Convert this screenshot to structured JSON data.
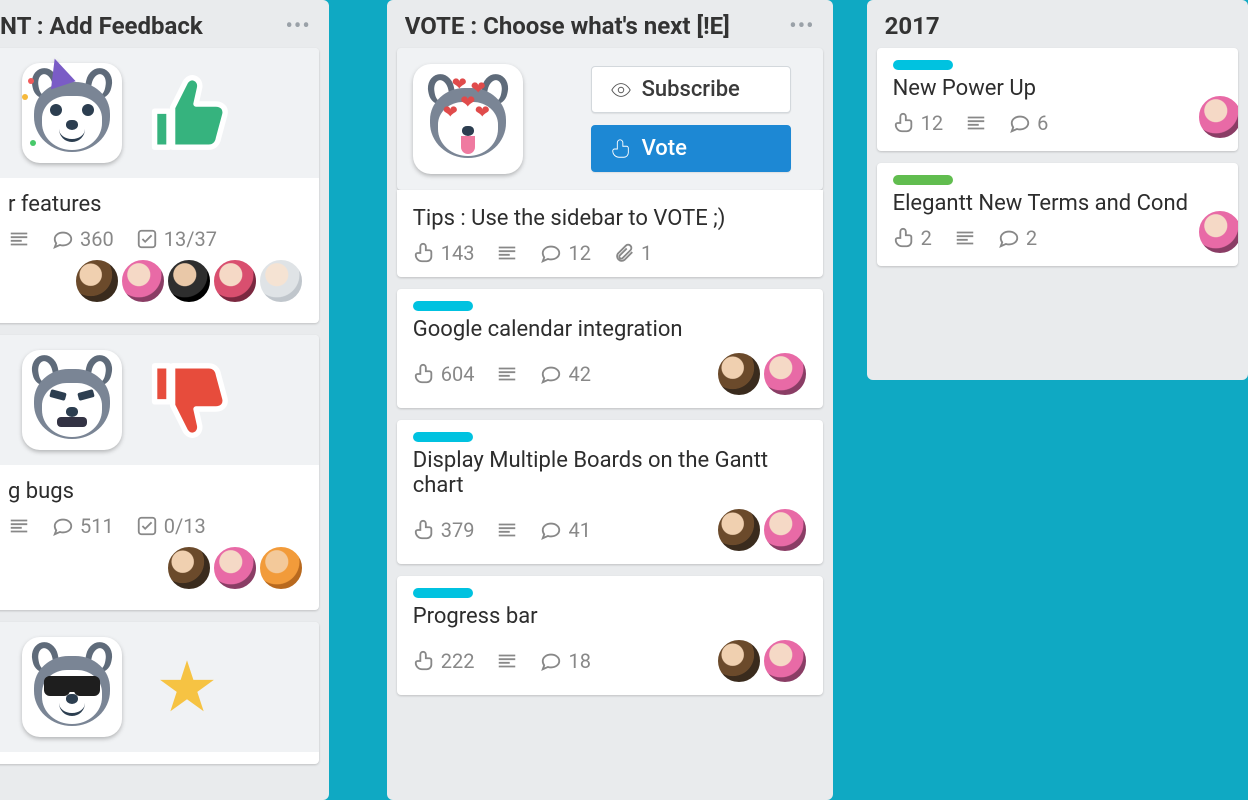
{
  "lists": {
    "feedback": {
      "title": "NT : Add Feedback",
      "cards": {
        "features": {
          "title": "r features",
          "comments": "360",
          "checklist": "13/37"
        },
        "bugs": {
          "title": "g bugs",
          "comments": "511",
          "checklist": "0/13"
        }
      }
    },
    "vote": {
      "title": "VOTE : Choose what's next [!E]",
      "subscribe": "Subscribe",
      "voteBtn": "Vote",
      "cards": {
        "tips": {
          "title": "Tips : Use the sidebar to VOTE ;)",
          "votes": "143",
          "comments": "12",
          "attachments": "1"
        },
        "gcal": {
          "title": "Google calendar integration",
          "votes": "604",
          "comments": "42"
        },
        "multi": {
          "title": "Display Multiple Boards on the Gantt chart",
          "votes": "379",
          "comments": "41"
        },
        "progress": {
          "title": "Progress bar",
          "votes": "222",
          "comments": "18"
        }
      }
    },
    "y2017": {
      "title": "2017",
      "cards": {
        "powerup": {
          "title": "New Power Up",
          "votes": "12",
          "comments": "6"
        },
        "terms": {
          "title": "Elegantt New Terms and Cond",
          "votes": "2",
          "comments": "2"
        }
      }
    }
  }
}
